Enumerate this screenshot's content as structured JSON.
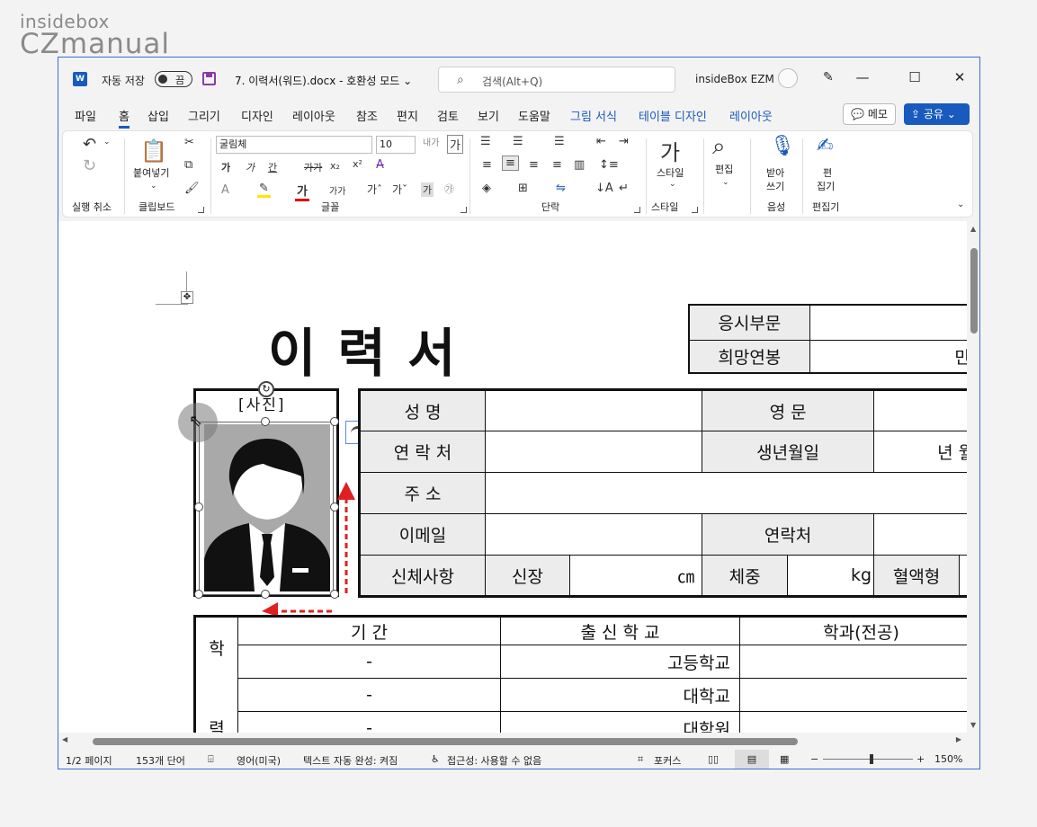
{
  "watermark": {
    "line1": "insidebox",
    "line2": "CZmanual"
  },
  "titlebar": {
    "autosave_label": "자동 저장",
    "autosave_state": "끔",
    "doc_title": "7. 이력서(워드).docx  -  호환성 모드 ⌄",
    "search_placeholder": "검색(Alt+Q)",
    "user": "insideBox EZM"
  },
  "menu": {
    "items": [
      "파일",
      "홈",
      "삽입",
      "그리기",
      "디자인",
      "레이아웃",
      "참조",
      "편지",
      "검토",
      "보기",
      "도움말",
      "그림 서식",
      "테이블 디자인",
      "레이아웃"
    ],
    "memo": "메모",
    "share": "공유"
  },
  "ribbon": {
    "undo_group": "실행 취소",
    "clipboard_group": "클립보드",
    "paste_label": "붙여넣기",
    "font_group": "글꼴",
    "font_name": "굴림체",
    "font_size": "10",
    "paragraph_group": "단락",
    "style_group": "스타일",
    "style_label": "스타일",
    "edit_label": "편집",
    "dictate_label1": "받아",
    "dictate_label2": "쓰기",
    "voice_group": "음성",
    "editor_label1": "편",
    "editor_label2": "집기",
    "editor_group": "편집기",
    "font_btn_bold": "가",
    "font_btn_italic": "가",
    "font_btn_underline": "간",
    "font_btn_strike": "가가",
    "font_btn_sub": "x₂",
    "font_btn_sup": "x²",
    "style_icon": "가"
  },
  "resume": {
    "title": "이      력      서",
    "photo_label": "[사진]",
    "top_right": [
      [
        "응시부문",
        ""
      ],
      [
        "희망연봉",
        "만"
      ]
    ],
    "rows": {
      "name": "성     명",
      "english": "영     문",
      "contact1": "연 락 처",
      "birth": "생년월일",
      "birth_value": "년     월",
      "address": "주      소",
      "email": "이메일",
      "contact2": "연락처",
      "body": "신체사항",
      "height": "신장",
      "height_unit": "㎝",
      "weight": "체중",
      "weight_unit": "kg",
      "blood": "혈액형"
    },
    "edu": {
      "side1": "학",
      "side2": "력",
      "headers": [
        "기     간",
        "출 신 학 교",
        "학과(전공)"
      ],
      "rows": [
        [
          "-",
          "고등학교",
          ""
        ],
        [
          "-",
          "대학교",
          ""
        ],
        [
          "-",
          "대학원",
          ""
        ]
      ]
    }
  },
  "statusbar": {
    "page": "1/2 페이지",
    "words": "153개 단어",
    "language": "영어(미국)",
    "autocomplete": "텍스트 자동 완성: 켜짐",
    "accessibility": "접근성: 사용할 수 없음",
    "focus": "포커스",
    "zoom": "150%"
  },
  "colors": {
    "accent": "#185abd",
    "arrow": "#e02020",
    "person_bg": "#a9a9a9"
  }
}
